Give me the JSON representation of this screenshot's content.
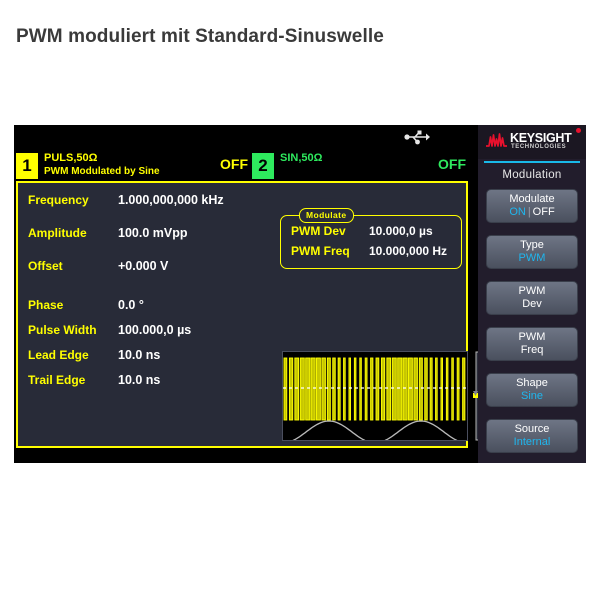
{
  "caption": "PWM moduliert mit Standard-Sinuswelle",
  "colors": {
    "channel1": "#ffff00",
    "channel2": "#2eea5e",
    "accent_cyan": "#1fb6ee",
    "keysight_red": "#e8112d",
    "panel_bg": "#282b38"
  },
  "status_bar": {
    "usb_icon": "usb-icon"
  },
  "channels": [
    {
      "number": "1",
      "line1": "PULS,50Ω",
      "line2": "PWM Modulated by Sine",
      "output": "OFF"
    },
    {
      "number": "2",
      "line1": "SIN,50Ω",
      "line2": "",
      "output": "OFF"
    }
  ],
  "parameters": [
    {
      "label": "Frequency",
      "value": "1.000,000,000 kHz"
    },
    {
      "label": "Amplitude",
      "value": "100.0 mVpp"
    },
    {
      "label": "Offset",
      "value": "+0.000 V"
    },
    {
      "label": "Phase",
      "value": "0.0 °"
    },
    {
      "label": "Pulse Width",
      "value": "100.000,0 µs"
    },
    {
      "label": "Lead Edge",
      "value": "10.0 ns"
    },
    {
      "label": "Trail Edge",
      "value": "10.0 ns"
    }
  ],
  "modulate_panel": {
    "tab_label": "Modulate",
    "rows": [
      {
        "label": "PWM Dev",
        "value": "10.000,0 µs"
      },
      {
        "label": "PWM Freq",
        "value": "10.000,000 Hz"
      }
    ]
  },
  "waveform": {
    "pulse_color": "#c8c800",
    "pulse_outline": "#ffff00",
    "modulating_color": "#b9b9b9",
    "center_line": "dashed-white",
    "description": "PWM pulse train modulated by sine"
  },
  "sidebar": {
    "brand": "KEYSIGHT",
    "brand_sub": "TECHNOLOGIES",
    "title": "Modulation",
    "softkeys": [
      {
        "name": "modulate",
        "line1": "Modulate",
        "on": "ON",
        "separator": "|",
        "off": "OFF",
        "active": "ON"
      },
      {
        "name": "type",
        "line1": "Type",
        "line2": "PWM",
        "accent": true
      },
      {
        "name": "pwm-dev",
        "line1": "PWM",
        "line2": "Dev",
        "accent": false
      },
      {
        "name": "pwm-freq",
        "line1": "PWM",
        "line2": "Freq",
        "accent": false
      },
      {
        "name": "shape",
        "line1": "Shape",
        "line2": "Sine",
        "accent": true
      },
      {
        "name": "source",
        "line1": "Source",
        "line2": "Internal",
        "accent": true
      }
    ]
  }
}
